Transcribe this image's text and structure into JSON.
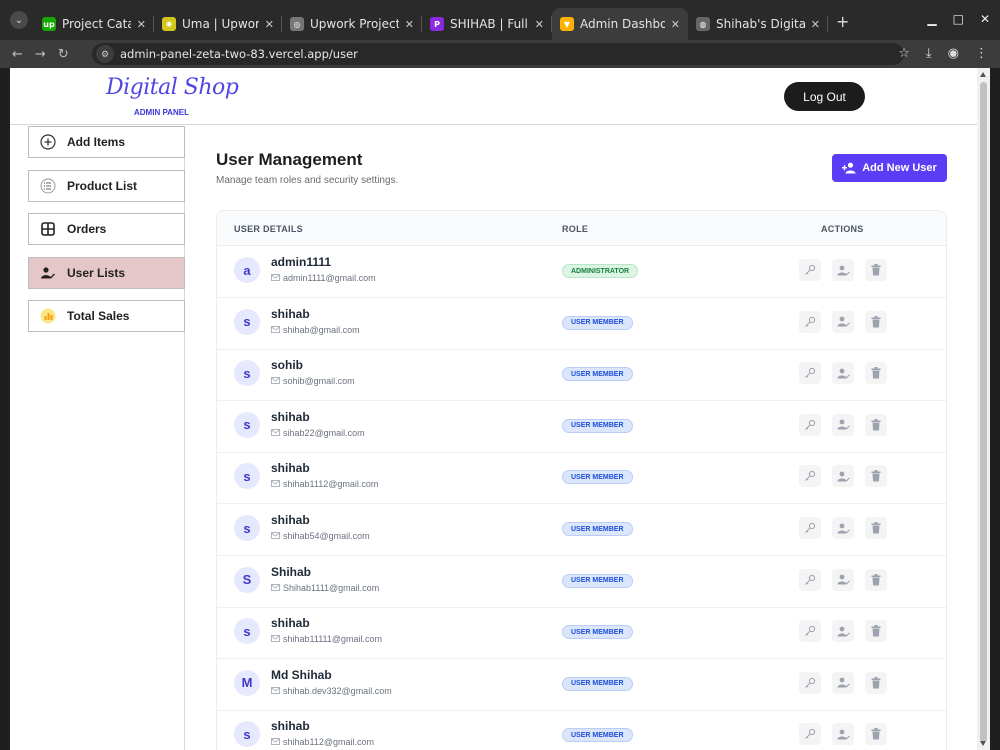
{
  "browser": {
    "tabs": [
      {
        "title": "Project Catalog | U",
        "favicon": "upwork-icon",
        "favicon_color": "#14a800",
        "favicon_text": "up"
      },
      {
        "title": "Uma | Upwork",
        "favicon": "sun-icon",
        "favicon_color": "#d4c61a",
        "favicon_text": "✺"
      },
      {
        "title": "Upwork Project Ca",
        "favicon": "upwork-icon",
        "favicon_color": "#777777",
        "favicon_text": "◎"
      },
      {
        "title": "SHIHAB | Full Stac",
        "favicon": "portfolio-icon",
        "favicon_color": "#8a2be2",
        "favicon_text": "P"
      },
      {
        "title": "Admin Dashboard",
        "favicon": "vite-icon",
        "favicon_color": "#ffb300",
        "favicon_text": "▼",
        "active": true
      },
      {
        "title": "Shihab's Digital Sh",
        "favicon": "globe-icon",
        "favicon_color": "#666666",
        "favicon_text": "◍"
      }
    ],
    "url": "admin-panel-zeta-two-83.vercel.app/user"
  },
  "header": {
    "logo": "Digital Shop",
    "logo_sub": "ADMIN PANEL",
    "logout_label": "Log Out"
  },
  "sidebar": {
    "items": [
      {
        "label": "Add Items",
        "icon": "plus-circle-icon"
      },
      {
        "label": "Product List",
        "icon": "list-icon"
      },
      {
        "label": "Orders",
        "icon": "grid-icon"
      },
      {
        "label": "User Lists",
        "icon": "user-edit-icon",
        "active": true
      },
      {
        "label": "Total Sales",
        "icon": "bar-chart-icon"
      }
    ]
  },
  "main": {
    "title": "User Management",
    "subtitle": "Manage team roles and security settings.",
    "add_button_label": "Add New User",
    "columns": {
      "details": "USER DETAILS",
      "role": "ROLE",
      "actions": "ACTIONS"
    },
    "users": [
      {
        "initial": "a",
        "name": "admin1111",
        "email": "admin1111@gmail.com",
        "role": "ADMINISTRATOR"
      },
      {
        "initial": "s",
        "name": "shihab",
        "email": "shihab@gmail.com",
        "role": "USER MEMBER"
      },
      {
        "initial": "s",
        "name": "sohib",
        "email": "sohib@gmail.com",
        "role": "USER MEMBER"
      },
      {
        "initial": "s",
        "name": "shihab",
        "email": "sihab22@gmail.com",
        "role": "USER MEMBER"
      },
      {
        "initial": "s",
        "name": "shihab",
        "email": "shihab1112@gmail.com",
        "role": "USER MEMBER"
      },
      {
        "initial": "s",
        "name": "shihab",
        "email": "shihab54@gmail.com",
        "role": "USER MEMBER"
      },
      {
        "initial": "S",
        "name": "Shihab",
        "email": "Shihab1111@gmail.com",
        "role": "USER MEMBER"
      },
      {
        "initial": "s",
        "name": "shihab",
        "email": "shihab11111@gmail.com",
        "role": "USER MEMBER"
      },
      {
        "initial": "M",
        "name": "Md Shihab",
        "email": "shihab.dev332@gmail.com",
        "role": "USER MEMBER"
      },
      {
        "initial": "s",
        "name": "shihab",
        "email": "shihab112@gmail.com",
        "role": "USER MEMBER"
      }
    ]
  },
  "colors": {
    "accent": "#5b3df5",
    "active_nav": "#e6c7c9",
    "admin_badge": "#15803d",
    "member_badge": "#1d4ed8"
  }
}
